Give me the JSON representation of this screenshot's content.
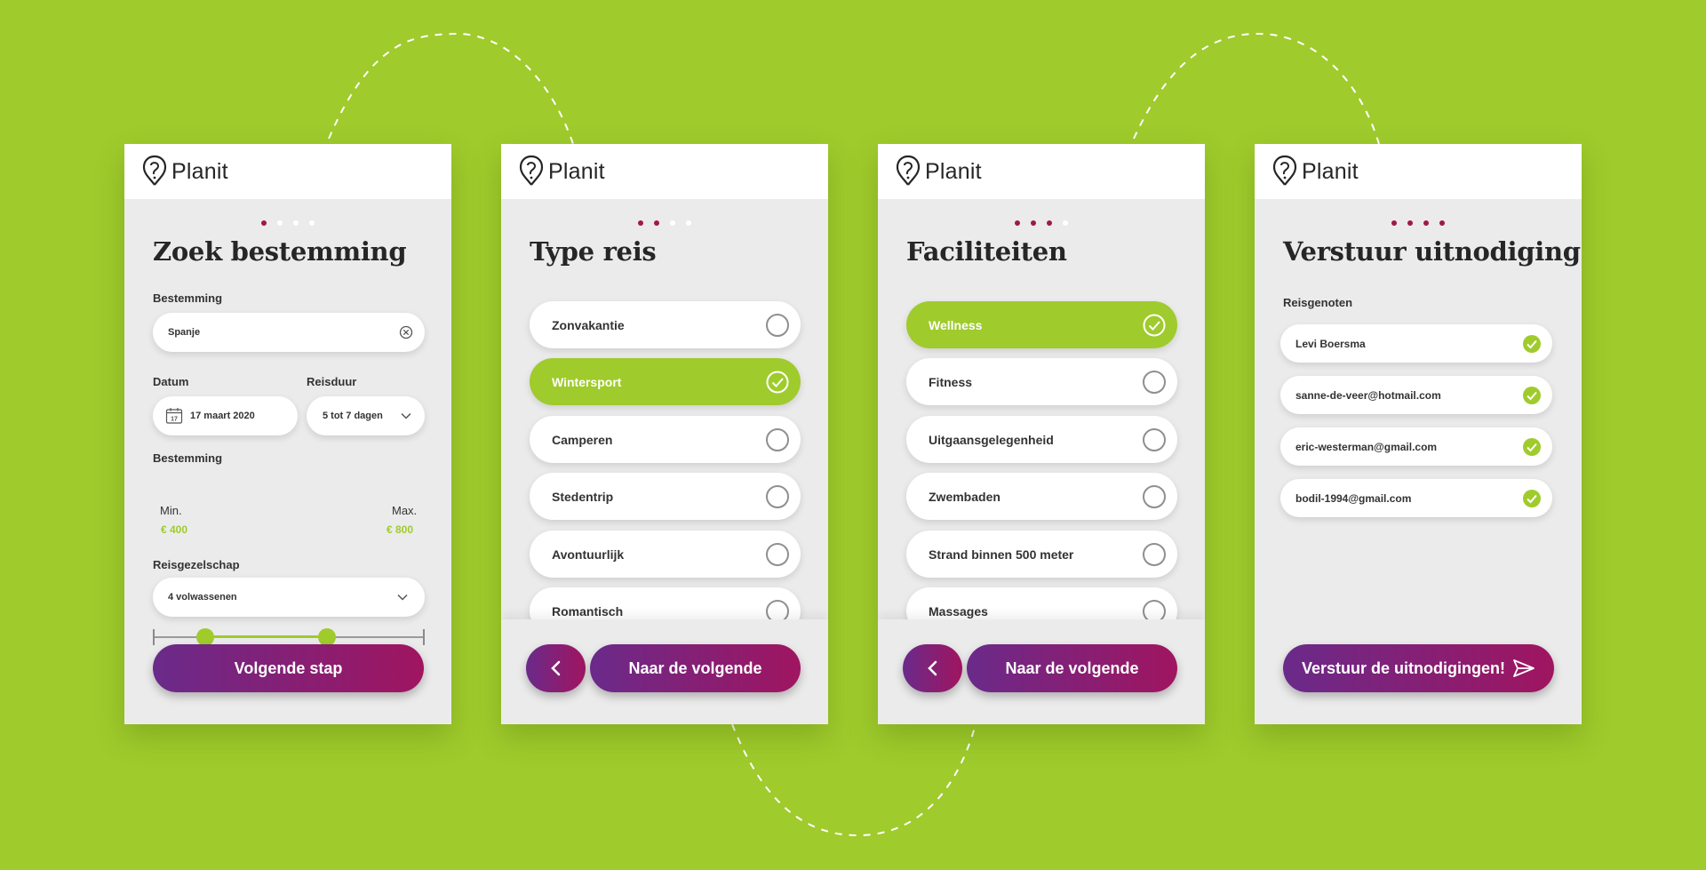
{
  "colors": {
    "background": "#9fcb2c",
    "accent_green": "#9fcb2c",
    "brand_purple": "#6a2a8a",
    "brand_magenta": "#a01560",
    "card": "#ebebeb"
  },
  "brand": "Planit",
  "screen1": {
    "title": "Zoek bestemming",
    "progress": {
      "step": 1,
      "total": 4
    },
    "destination": {
      "label": "Bestemming",
      "value": "Spanje",
      "clear_icon": "clear-icon"
    },
    "date": {
      "label": "Datum",
      "value": "17 maart 2020",
      "icon": "calendar-icon",
      "icon_text": "17"
    },
    "duration": {
      "label": "Reisduur",
      "value": "5 tot 7 dagen"
    },
    "budget": {
      "label": "Bestemming",
      "min_label": "Min.",
      "max_label": "Max.",
      "min_value": "€ 400",
      "max_value": "€ 800"
    },
    "company": {
      "label": "Reisgezelschap",
      "value": "4 volwassenen"
    },
    "next_button": "Volgende stap"
  },
  "screen2": {
    "title": "Type reis",
    "progress": {
      "step": 2,
      "total": 4
    },
    "options": [
      {
        "label": "Zonvakantie",
        "selected": false
      },
      {
        "label": "Wintersport",
        "selected": true
      },
      {
        "label": "Camperen",
        "selected": false
      },
      {
        "label": "Stedentrip",
        "selected": false
      },
      {
        "label": "Avontuurlijk",
        "selected": false
      },
      {
        "label": "Romantisch",
        "selected": false
      }
    ],
    "next_button": "Naar de volgende"
  },
  "screen3": {
    "title": "Faciliteiten",
    "progress": {
      "step": 3,
      "total": 4
    },
    "options": [
      {
        "label": "Wellness",
        "selected": true
      },
      {
        "label": "Fitness",
        "selected": false
      },
      {
        "label": "Uitgaansgelegenheid",
        "selected": false
      },
      {
        "label": "Zwembaden",
        "selected": false
      },
      {
        "label": "Strand binnen 500 meter",
        "selected": false
      },
      {
        "label": "Massages",
        "selected": false
      }
    ],
    "next_button": "Naar de volgende"
  },
  "screen4": {
    "title": "Verstuur uitnodiging",
    "progress": {
      "step": 4,
      "total": 4
    },
    "companions_label": "Reisgenoten",
    "companions": [
      {
        "name": "Levi Boersma",
        "checked": true
      },
      {
        "name": "sanne-de-veer@hotmail.com",
        "checked": true
      },
      {
        "name": "eric-westerman@gmail.com",
        "checked": true
      },
      {
        "name": "bodil-1994@gmail.com",
        "checked": true
      }
    ],
    "send_button": "Verstuur de uitnodigingen!",
    "send_icon": "paper-plane-icon"
  }
}
